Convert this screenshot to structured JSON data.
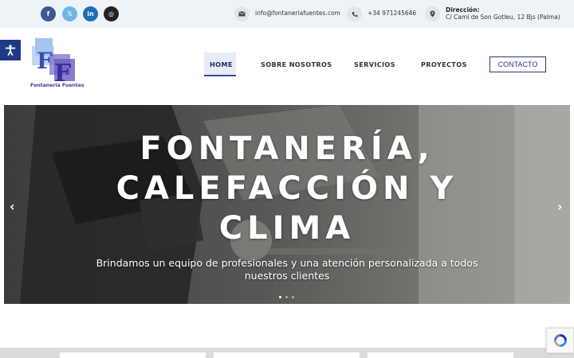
{
  "social": [
    {
      "name": "facebook",
      "glyph": "f",
      "color": "#3b5998"
    },
    {
      "name": "x",
      "glyph": "𝕏",
      "color": "#71b7e6"
    },
    {
      "name": "linkedin",
      "glyph": "in",
      "color": "#1a6fb5"
    },
    {
      "name": "instagram",
      "glyph": "◎",
      "color": "#222222"
    }
  ],
  "contact": {
    "email": "info@fontaneriafuentes.com",
    "phone": "+34 971245646",
    "address_label": "Dirección:",
    "address": "C/ Cami de Son Gotleu, 12 Bjs (Palma)"
  },
  "brand": {
    "logo_letters": "FF",
    "logo_text": "Fontanería Fuentes"
  },
  "nav": {
    "items": [
      {
        "label": "HOME",
        "active": true
      },
      {
        "label": "SOBRE NOSOTROS",
        "active": false
      },
      {
        "label": "SERVICIOS",
        "active": false
      },
      {
        "label": "PROYECTOS",
        "active": false
      }
    ],
    "cta": "CONTACTO"
  },
  "hero": {
    "title_line1": "FONTANERÍA,",
    "title_line2": "CALEFACCIÓN Y",
    "title_line3": "CLIMA",
    "subtitle": "Brindamos un equipo de profesionales y una atención personalizada a todos nuestros clientes",
    "prev_arrow": "‹",
    "next_arrow": "›",
    "slide_count": 3,
    "active_slide": 1
  },
  "colors": {
    "accent": "#2a3480",
    "topbar": "#eef3f8"
  }
}
